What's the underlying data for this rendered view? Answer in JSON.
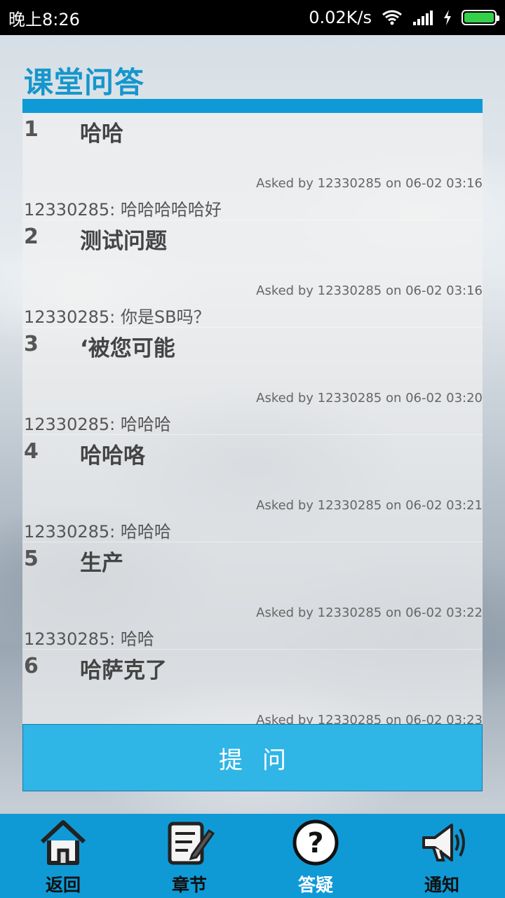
{
  "status_bar": {
    "time": "晚上8:26",
    "network_speed": "0.02K/s",
    "battery_color": "#35d04a",
    "icons": [
      "wifi-icon",
      "signal-icon",
      "charging-icon",
      "battery-icon"
    ]
  },
  "header": {
    "title": "课堂问答",
    "accent_color": "#0f9ad6"
  },
  "questions": [
    {
      "number": "1",
      "title": "哈哈",
      "meta": "Asked by 12330285 on 06-02 03:16",
      "reply": "12330285: 哈哈哈哈哈好"
    },
    {
      "number": "2",
      "title": "测试问题",
      "meta": "Asked by 12330285 on 06-02 03:16",
      "reply": "12330285: 你是SB吗？"
    },
    {
      "number": "3",
      "title": "‘被您可能",
      "meta": "Asked by 12330285 on 06-02 03:20",
      "reply": "12330285: 哈哈哈"
    },
    {
      "number": "4",
      "title": "哈哈咯",
      "meta": "Asked by 12330285 on 06-02 03:21",
      "reply": "12330285: 哈哈哈"
    },
    {
      "number": "5",
      "title": "生产",
      "meta": "Asked by 12330285 on 06-02 03:22",
      "reply": "12330285: 哈哈"
    },
    {
      "number": "6",
      "title": "哈萨克了",
      "meta": "Asked by 12330285 on 06-02 03:23",
      "reply": ""
    }
  ],
  "ask_button": {
    "label": "提问",
    "color": "#30b5e7"
  },
  "bottom_nav": {
    "items": [
      {
        "label": "返回",
        "icon": "home-icon",
        "active": false
      },
      {
        "label": "章节",
        "icon": "notepad-pencil-icon",
        "active": false
      },
      {
        "label": "答疑",
        "icon": "question-mark-icon",
        "active": true
      },
      {
        "label": "通知",
        "icon": "megaphone-icon",
        "active": false
      }
    ]
  }
}
